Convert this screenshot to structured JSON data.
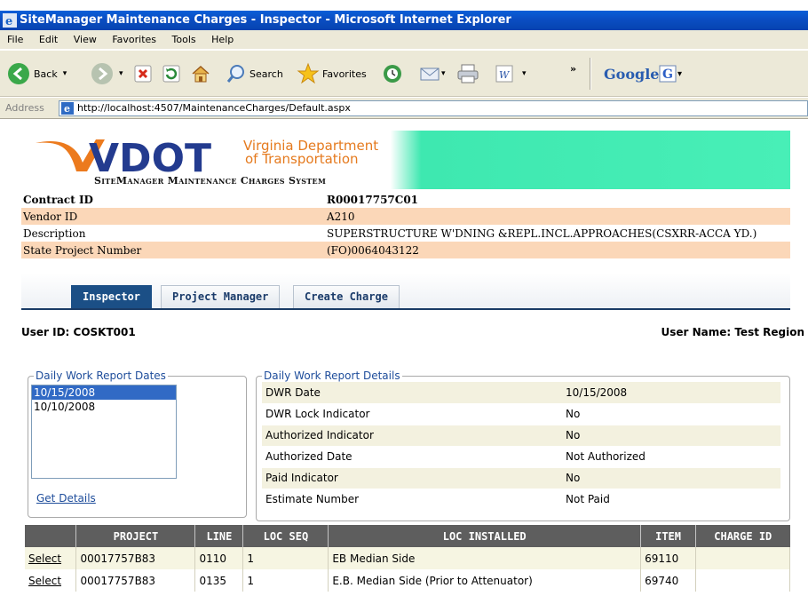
{
  "window": {
    "title": "SiteManager Maintenance Charges - Inspector - Microsoft Internet Explorer"
  },
  "menu": [
    "File",
    "Edit",
    "View",
    "Favorites",
    "Tools",
    "Help"
  ],
  "toolbar": {
    "back": "Back",
    "search": "Search",
    "favorites": "Favorites",
    "chevron": "»",
    "google": "Google"
  },
  "address": {
    "label": "Address",
    "url": "http://localhost:4507/MaintenanceCharges/Default.aspx"
  },
  "brand": {
    "logo_text": "VDOT",
    "dept_line1": "Virginia Department",
    "dept_line2": "of Transportation",
    "system_name": "SiteManager Maintenance Charges System"
  },
  "contract": [
    {
      "label": "Contract ID",
      "value": "R00017757C01"
    },
    {
      "label": "Vendor ID",
      "value": "A210"
    },
    {
      "label": "Description",
      "value": "SUPERSTRUCTURE W'DNING &REPL.INCL.APPROACHES(CSXRR-ACCA YD.)"
    },
    {
      "label": "State Project Number",
      "value": "(FO)0064043122"
    }
  ],
  "tabs": [
    {
      "label": "Inspector",
      "active": true
    },
    {
      "label": "Project Manager",
      "active": false
    },
    {
      "label": "Create Charge",
      "active": false
    }
  ],
  "user": {
    "id_text": "User ID: COSKT001",
    "name_text": "User Name: Test Region"
  },
  "dwr_dates": {
    "legend": "Daily Work Report Dates",
    "items": [
      "10/15/2008",
      "10/10/2008"
    ],
    "selected": "10/15/2008",
    "get_details": "Get Details"
  },
  "dwr_details": {
    "legend": "Daily Work Report Details",
    "rows": [
      {
        "label": "DWR Date",
        "value": "10/15/2008"
      },
      {
        "label": "DWR Lock Indicator",
        "value": "No"
      },
      {
        "label": "Authorized Indicator",
        "value": "No"
      },
      {
        "label": "Authorized Date",
        "value": "Not Authorized"
      },
      {
        "label": "Paid Indicator",
        "value": "No"
      },
      {
        "label": "Estimate Number",
        "value": "Not Paid"
      }
    ]
  },
  "grid": {
    "headers": [
      "",
      "PROJECT",
      "LINE",
      "LOC SEQ",
      "LOC INSTALLED",
      "ITEM",
      "CHARGE ID"
    ],
    "rows": [
      {
        "select": "Select",
        "project": "00017757B83",
        "line": "0110",
        "loc_seq": "1",
        "loc_installed": "EB Median Side",
        "item": "69110",
        "charge_id": ""
      },
      {
        "select": "Select",
        "project": "00017757B83",
        "line": "0135",
        "loc_seq": "1",
        "loc_installed": "E.B. Median Side (Prior to Attenuator)",
        "item": "69740",
        "charge_id": ""
      }
    ]
  }
}
